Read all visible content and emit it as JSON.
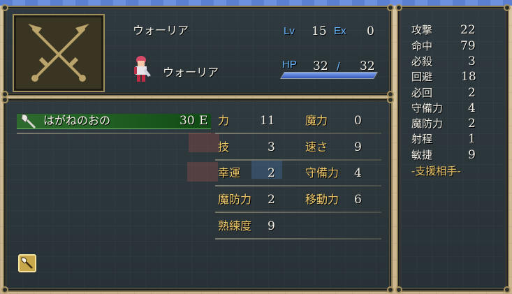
{
  "unit": {
    "class_name": "ウォーリア",
    "unit_name": "ウォーリア",
    "lv_label": "Lv",
    "lv": "15",
    "ex_label": "Ex",
    "ex": "0",
    "hp_label": "HP",
    "hp_current": "32",
    "hp_sep": "/",
    "hp_max": "32",
    "hp_fraction": 1.0
  },
  "weapon": {
    "name": "はがねのおの",
    "uses": "30",
    "rank": "E",
    "icon": "axe-icon"
  },
  "stats": [
    {
      "label": "力",
      "value": "11"
    },
    {
      "label": "魔力",
      "value": "0"
    },
    {
      "label": "技",
      "value": "3"
    },
    {
      "label": "速さ",
      "value": "9"
    },
    {
      "label": "幸運",
      "value": "2"
    },
    {
      "label": "守備力",
      "value": "4"
    },
    {
      "label": "魔防力",
      "value": "2"
    },
    {
      "label": "移動力",
      "value": "6"
    },
    {
      "label": "熟練度",
      "value": "9"
    }
  ],
  "combat": [
    {
      "label": "攻撃",
      "value": "22"
    },
    {
      "label": "命中",
      "value": "79"
    },
    {
      "label": "必殺",
      "value": "3"
    },
    {
      "label": "回避",
      "value": "18"
    },
    {
      "label": "必回",
      "value": "2"
    },
    {
      "label": "守備力",
      "value": "4"
    },
    {
      "label": "魔防力",
      "value": "2"
    },
    {
      "label": "射程",
      "value": "1"
    },
    {
      "label": "敏捷",
      "value": "9"
    }
  ],
  "support_label": "-支援相手-",
  "colors": {
    "panel": "#2f3a40",
    "gold_text": "#efc868",
    "blue_text": "#69b6ff",
    "weapon_highlight": "#1c5a20"
  }
}
